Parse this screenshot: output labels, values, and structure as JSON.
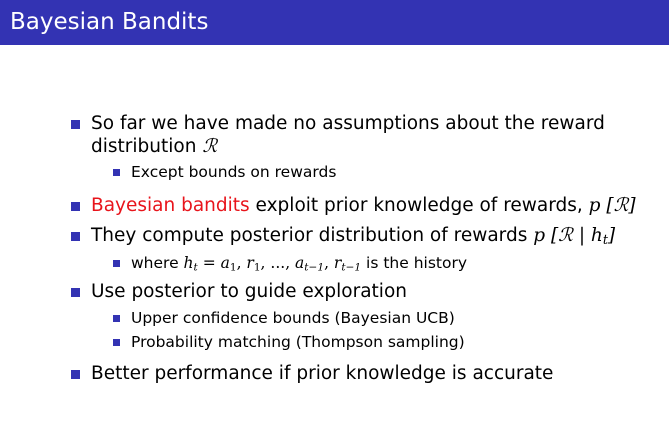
{
  "slide": {
    "title": "Bayesian Bandits",
    "bullets": {
      "b1": {
        "text_line1": "So far we have made no assumptions about the reward",
        "text_line2": "distribution ",
        "symbol": "ℛ",
        "sub": {
          "text": "Except bounds on rewards"
        }
      },
      "b2": {
        "highlight": "Bayesian bandits",
        "text": " exploit prior knowledge of rewards, ",
        "math": "p [ℛ]"
      },
      "b3": {
        "text": "They compute posterior distribution of rewards ",
        "math_open": "p [ℛ | h",
        "math_sub": "t",
        "math_close": "]",
        "sub": {
          "prefix": "where ",
          "h": "h",
          "t": "t",
          "eq": " = ",
          "a": "a",
          "one": "1",
          "comma": ", ",
          "r": "r",
          "dots": "...",
          "tm1": "t−1",
          "suffix": " is the history"
        }
      },
      "b4": {
        "text": "Use posterior to guide exploration",
        "sub1": "Upper confidence bounds (Bayesian UCB)",
        "sub2": "Probability matching (Thompson sampling)"
      },
      "b5": {
        "text": "Better performance if prior knowledge is accurate"
      }
    }
  },
  "colors": {
    "title_bar": "#3333b3",
    "bullet": "#3333b3",
    "highlight": "#e8141b"
  },
  "icons": {
    "bullet": "square-bullet-icon"
  }
}
